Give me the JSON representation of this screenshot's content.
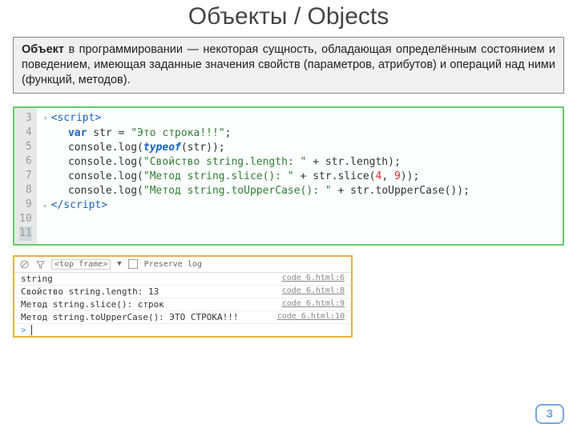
{
  "title": {
    "ru": "Объекты",
    "sep": " / ",
    "en_bold": "Object",
    "en_tail": "s"
  },
  "definition": {
    "bold": "Объект",
    "rest": " в программировании — некоторая сущность, обладающая определённым состоянием и поведением, имеющая заданные значения свойств (параметров, атрибутов) и операций над ними (функций, методов)."
  },
  "code": {
    "line_numbers": [
      "3",
      "4",
      "5",
      "6",
      "7",
      "8",
      "9",
      "10",
      "11"
    ],
    "highlight_index": 8,
    "lines": {
      "l3": {
        "open": "<script>"
      },
      "l4": {
        "kw": "var",
        "mid": " str = ",
        "str": "\"Это строка!!!\"",
        "end": ";"
      },
      "l5": {
        "blank": ""
      },
      "l6": {
        "pre": "    console.log(",
        "kw2": "typeof",
        "post": "(str));"
      },
      "l7": {
        "blank": ""
      },
      "l8": {
        "pre": "    console.log(",
        "s1": "\"Свойство string.length: \"",
        "mid": " + str.length);"
      },
      "l9": {
        "pre": "    console.log(",
        "s1": "\"Метод string.slice(): \"",
        "mid": " + str.slice(",
        "n1": "4",
        "c": ", ",
        "n2": "9",
        "end": "));"
      },
      "l10": {
        "pre": "    console.log(",
        "s1": "\"Метод string.toUpperCase(): \"",
        "mid": " + str.toUpperCase());"
      },
      "l11": {
        "close": "</scr"
      }
    }
  },
  "console": {
    "frame_label": "<top frame>",
    "arrow": "▼",
    "preserve": "Preserve log",
    "rows": [
      {
        "msg": "string",
        "src": "code 6.html:6"
      },
      {
        "msg": "Свойство string.length: 13",
        "src": "code 6.html:8"
      },
      {
        "msg": "Метод string.slice(): строк",
        "src": "code 6.html:9"
      },
      {
        "msg": "Метод string.toUpperCase(): ЭТО СТРОКА!!!",
        "src": "code 6.html:10"
      }
    ],
    "prompt": "> "
  },
  "page_number": "3"
}
